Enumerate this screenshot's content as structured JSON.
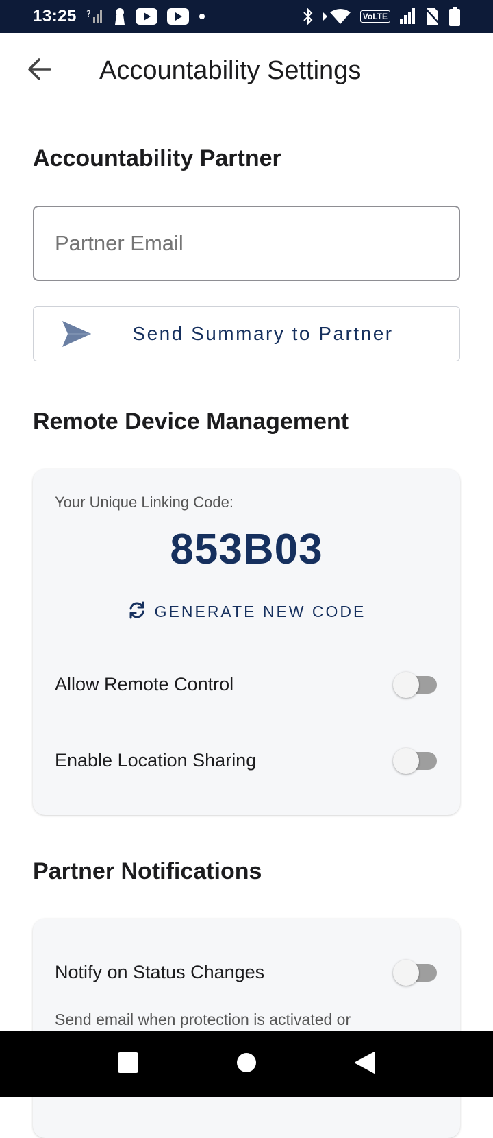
{
  "status_bar": {
    "time": "13:25",
    "network_badge": "VoLTE"
  },
  "app_bar": {
    "title": "Accountability Settings"
  },
  "partner_section": {
    "title": "Accountability Partner",
    "email_placeholder": "Partner Email",
    "email_value": "",
    "send_button_label": "Send Summary to Partner"
  },
  "remote_section": {
    "title": "Remote Device Management",
    "code_caption": "Your Unique Linking Code:",
    "linking_code": "853B03",
    "generate_button_label": "GENERATE NEW CODE",
    "toggles": [
      {
        "label": "Allow Remote Control",
        "on": false
      },
      {
        "label": "Enable Location Sharing",
        "on": false
      }
    ]
  },
  "notifications_section": {
    "title": "Partner Notifications",
    "toggles": [
      {
        "label": "Notify on Status Changes",
        "on": false
      }
    ],
    "description": "Send email when protection is activated or"
  },
  "colors": {
    "status_bar_bg": "#0d1b38",
    "accent": "#16305e",
    "card_bg": "#f6f7f9",
    "switch_off_track": "#9e9e9e"
  },
  "icons": {
    "back": "arrow-left-icon",
    "send": "send-icon",
    "refresh": "refresh-icon"
  }
}
